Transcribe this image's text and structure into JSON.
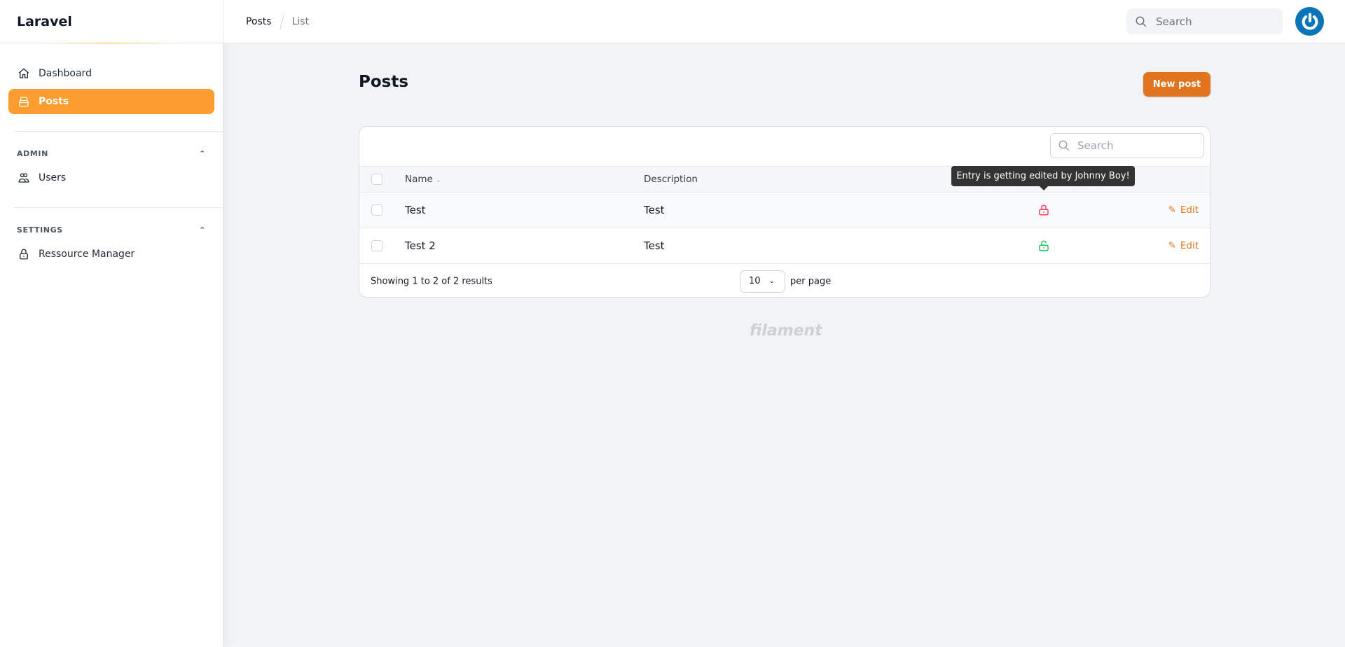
{
  "app": {
    "name": "Laravel"
  },
  "sidebar": {
    "items": [
      {
        "label": "Dashboard",
        "icon": "home-icon"
      },
      {
        "label": "Posts",
        "icon": "archive-icon",
        "active": true
      }
    ],
    "groups": [
      {
        "label": "ADMIN",
        "items": [
          {
            "label": "Users",
            "icon": "users-icon"
          }
        ]
      },
      {
        "label": "SETTINGS",
        "items": [
          {
            "label": "Ressource Manager",
            "icon": "lock-icon"
          }
        ]
      }
    ]
  },
  "breadcrumb": [
    "Posts",
    "List"
  ],
  "topbar": {
    "search_placeholder": "Search"
  },
  "page": {
    "title": "Posts",
    "new_button": "New post"
  },
  "table": {
    "search_placeholder": "Search",
    "columns": [
      "Name",
      "Description"
    ],
    "rows": [
      {
        "name": "Test",
        "description": "Test",
        "locked": true,
        "action": "Edit"
      },
      {
        "name": "Test 2",
        "description": "Test",
        "locked": false,
        "action": "Edit"
      }
    ],
    "tooltip": "Entry is getting edited by Johnny Boy!",
    "summary": "Showing 1 to 2 of 2 results",
    "per_page": "10",
    "per_page_label": "per page"
  },
  "footer": {
    "logo": "filament"
  },
  "colors": {
    "primary": "#fd9c2f",
    "button": "#e1741f",
    "locked": "#f43f5e",
    "unlocked": "#22c55e"
  }
}
